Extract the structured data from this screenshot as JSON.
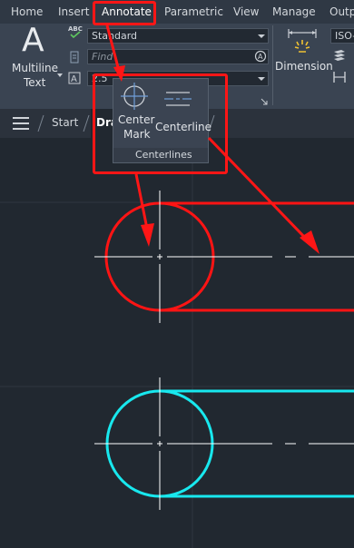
{
  "menu": {
    "tabs": [
      "Home",
      "Insert",
      "Annotate",
      "Parametric",
      "View",
      "Manage",
      "Outp"
    ]
  },
  "ribbon": {
    "multiline_text": {
      "line1": "Multiline",
      "line2": "Text",
      "big_glyph": "A"
    },
    "text_style_value": "Standard",
    "find_placeholder": "Find",
    "text_height_value": "2.5",
    "dimension_label": "Dimension",
    "dim_style_value": "ISO-",
    "abc_label": "ABC"
  },
  "tabs": {
    "start": "Start",
    "drawing": "Dra"
  },
  "popup": {
    "center_mark_line1": "Center",
    "center_mark_line2": "Mark",
    "centerline_label": "Centerline",
    "panel_title": "Centerlines"
  },
  "colors": {
    "highlight": "#ff1616",
    "red_geometry": "#ff1414",
    "cyan_geometry": "#18e8ee",
    "canvas_bg": "#212830",
    "ribbon_bg": "#3a4452"
  }
}
